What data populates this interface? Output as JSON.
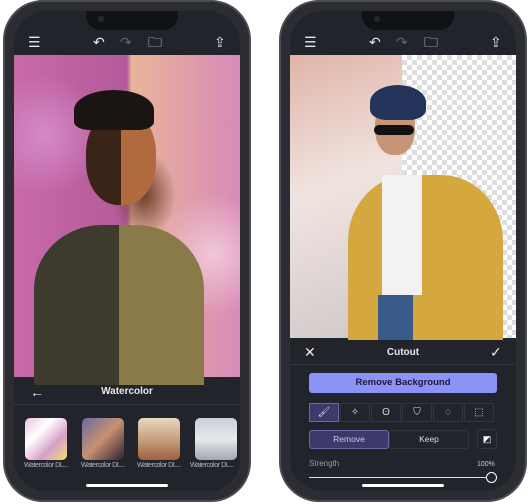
{
  "left_phone": {
    "toolbar": {
      "menu": "menu-icon",
      "undo": "undo-icon",
      "redo": "redo-icon",
      "folder": "folder-icon",
      "share": "share-icon"
    },
    "panel": {
      "title": "Watercolor",
      "back": "arrow-left-icon"
    },
    "filters": [
      {
        "label": "Watercolor DL..."
      },
      {
        "label": "Watercolor DL..."
      },
      {
        "label": "Watercolor DL..."
      },
      {
        "label": "Watercolor DL..."
      }
    ]
  },
  "right_phone": {
    "panel": {
      "title": "Cutout",
      "close": "close-icon",
      "confirm": "check-icon"
    },
    "remove_bg_label": "Remove Background",
    "tools": [
      "brush-icon",
      "magic-wand-icon",
      "lasso-icon",
      "polygon-lasso-icon",
      "ellipse-select-icon",
      "rect-select-icon"
    ],
    "mode": {
      "remove": "Remove",
      "keep": "Keep",
      "selected": "Remove"
    },
    "strength": {
      "label": "Strength",
      "value_text": "100%",
      "value": 100
    }
  },
  "colors": {
    "accent": "#8b93f8",
    "selected": "#3d3a6b",
    "bg": "#22242b"
  }
}
